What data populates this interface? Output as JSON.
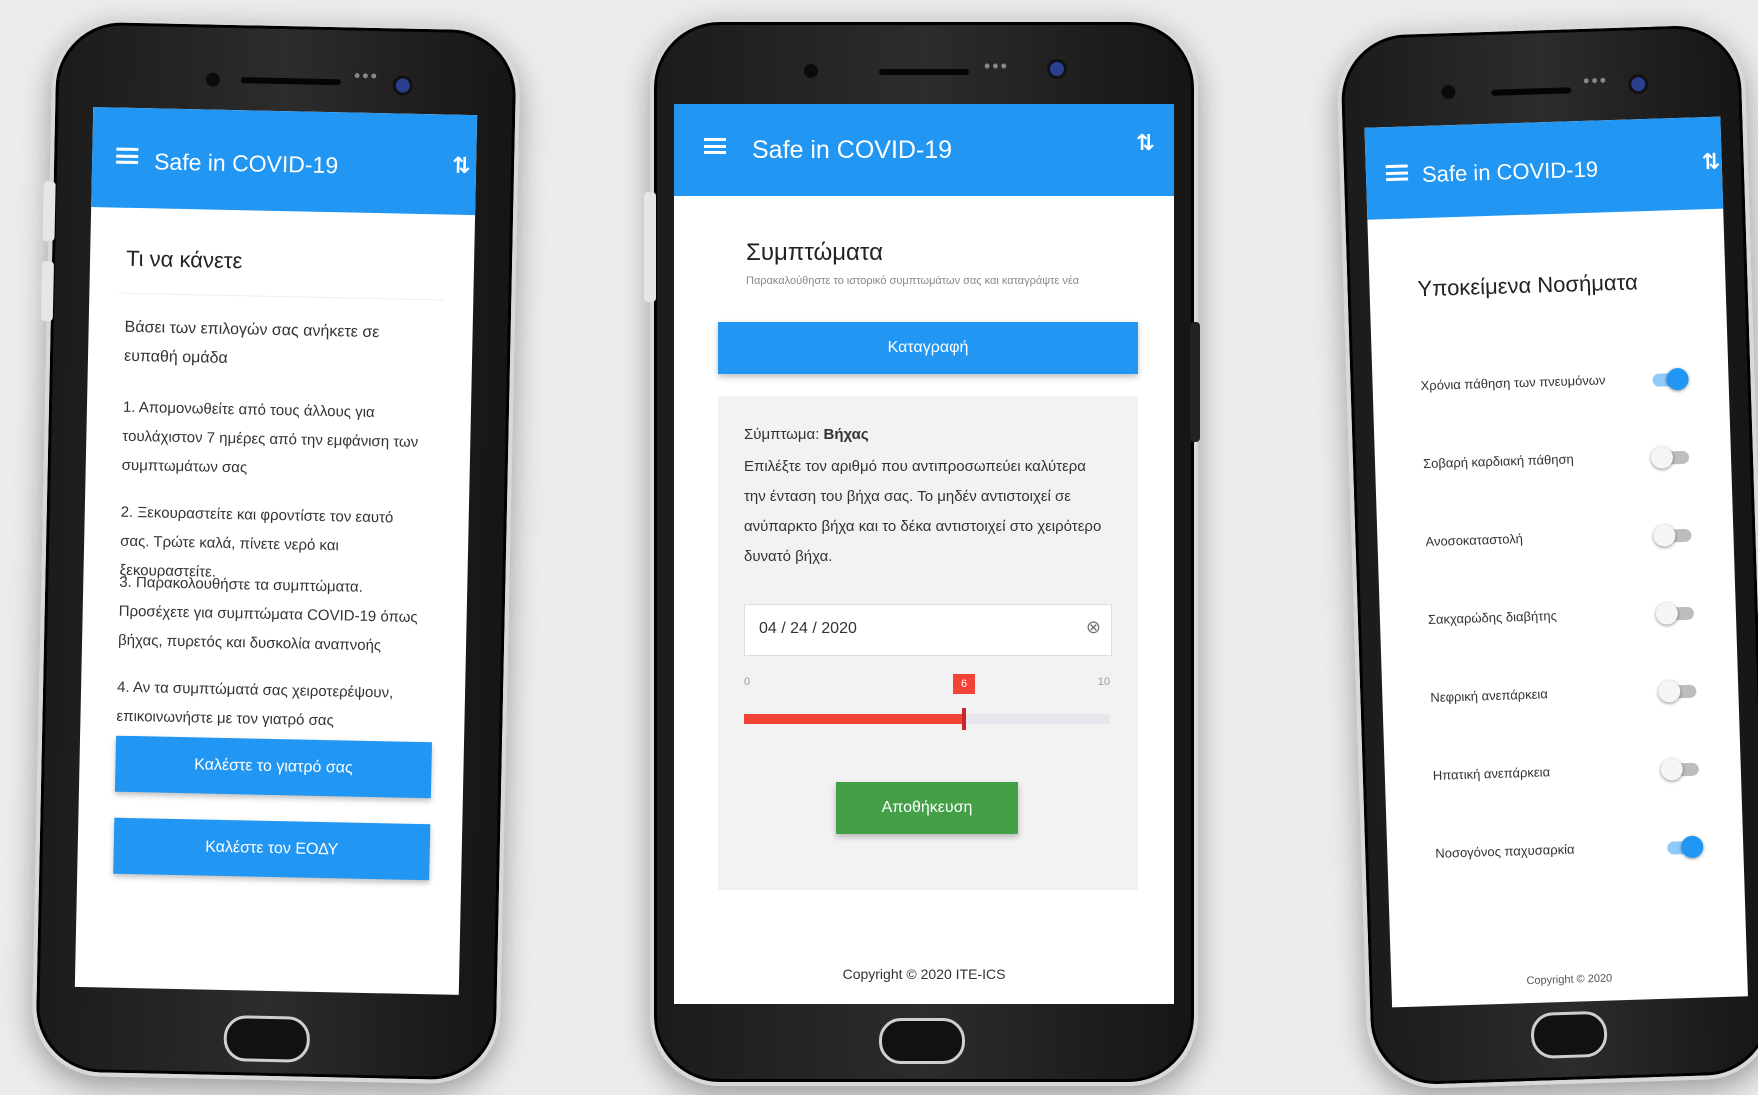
{
  "app": {
    "title": "Safe in COVID-19"
  },
  "phone1": {
    "heading": "Τι να κάνετε",
    "intro": "Βάσει των επιλογών σας ανήκετε σε ευπαθή ομάδα",
    "steps": [
      "1. Απομονωθείτε από τους άλλους για τουλάχιστον 7 ημέρες από την εμφάνιση των συμπτωμάτων σας",
      "2. Ξεκουραστείτε και φροντίστε τον εαυτό σας. Τρώτε καλά, πίνετε νερό και ξεκουραστείτε.",
      "3. Παρακολουθήστε τα συμπτώματα. Προσέχετε για συμπτώματα COVID-19 όπως βήχας, πυρετός και δυσκολία αναπνοής",
      "4. Αν τα συμπτώματά σας χειροτερέψουν, επικοινωνήστε με τον γιατρό σας"
    ],
    "call_doctor": "Καλέστε το γιατρό σας",
    "call_eody": "Καλέστε τον ΕΟΔΥ"
  },
  "phone2": {
    "heading": "Συμπτώματα",
    "subheading": "Παρακαλούθηστε το ιστορικό συμπτωμάτων σας και καταγράψτε νέα",
    "record_button": "Καταγραφή",
    "symptom_prefix": "Σύμπτωμα: ",
    "symptom_name": "Βήχας",
    "description": "Επιλέξτε τον αριθμό που αντιπροσωπεύει καλύτερα την ένταση του βήχα σας. Το μηδέν αντιστοιχεί σε ανύπαρκτο βήχα και το δέκα αντιστοιχεί στο χειρότερο δυνατό βήχα.",
    "date_value": "04 / 24 / 2020",
    "slider": {
      "min": "0",
      "max": "10",
      "value": 6,
      "value_label": "6",
      "min_value": 0,
      "max_value": 10
    },
    "save_button": "Αποθήκευση",
    "footer": "Copyright © 2020 ITE-ICS"
  },
  "phone3": {
    "heading": "Υποκείμενα Νοσήματα",
    "conditions": [
      {
        "label": "Χρόνια πάθηση των πνευμόνων",
        "on": true
      },
      {
        "label": "Σοβαρή καρδιακή πάθηση",
        "on": false
      },
      {
        "label": "Ανοσοκαταστολή",
        "on": false
      },
      {
        "label": "Σακχαρώδης διαβήτης",
        "on": false
      },
      {
        "label": "Νεφρική ανεπάρκεια",
        "on": false
      },
      {
        "label": "Ηπατική ανεπάρκεια",
        "on": false
      },
      {
        "label": "Νοσογόνος παχυσαρκία",
        "on": true
      }
    ],
    "footer": "Copyright © 2020"
  },
  "colors": {
    "appbar": "#2196f3",
    "save": "#43a047",
    "slider": "#f44336"
  }
}
